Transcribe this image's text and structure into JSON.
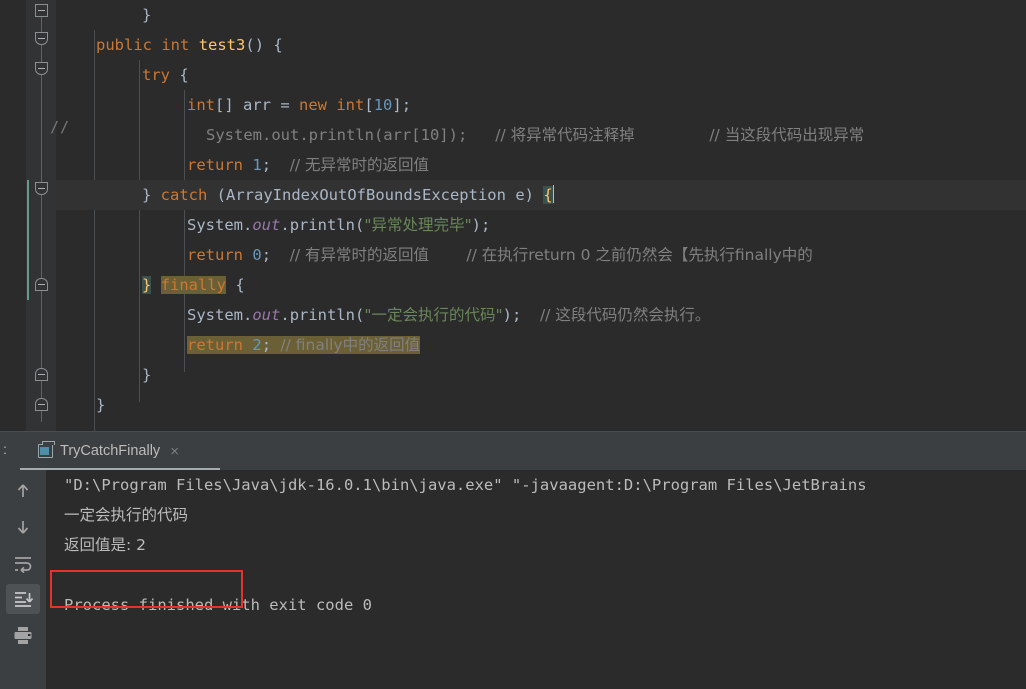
{
  "window": {
    "theme_background": "#2b2b2b",
    "accent": "#4e8fa8"
  },
  "editor": {
    "gutter": {
      "comment_marker": "//",
      "fold_markers": [
        "collapse",
        "collapse",
        "collapse",
        "collapse",
        "expanded-end",
        "expanded-end",
        "expanded-end"
      ]
    },
    "lines": [
      {
        "indent": "        ",
        "text": "}"
      },
      {
        "indent": "    ",
        "text": "public int test3() {"
      },
      {
        "indent": "        ",
        "text": "try {"
      },
      {
        "indent": "            ",
        "text": "int[] arr = new int[10];"
      },
      {
        "indent": "              ",
        "text": "System.out.println(arr[10]);   // 将异常代码注释掉        // 当这段代码出现异常"
      },
      {
        "indent": "            ",
        "text": "return 1;  // 无异常时的返回值"
      },
      {
        "indent": "        ",
        "text": "} catch (ArrayIndexOutOfBoundsException e) {"
      },
      {
        "indent": "            ",
        "text": "System.out.println(\"异常处理完毕\");"
      },
      {
        "indent": "            ",
        "text": "return 0;  // 有异常时的返回值    // 在执行return 0 之前仍然会【先执行finally中的"
      },
      {
        "indent": "        ",
        "text": "} finally {"
      },
      {
        "indent": "            ",
        "text": "System.out.println(\"一定会执行的代码\");  // 这段代码仍然会执行。"
      },
      {
        "indent": "            ",
        "text": "return 2; // finally中的返回值"
      },
      {
        "indent": "        ",
        "text": "}"
      },
      {
        "indent": "    ",
        "text": "}"
      }
    ],
    "tokens": {
      "kw_public": "public",
      "kw_int": "int",
      "method_name": "test3",
      "kw_try": "try",
      "kw_new": "new",
      "kw_return": "return",
      "kw_catch": "catch",
      "kw_finally": "finally",
      "exception_type": "ArrayIndexOutOfBoundsException",
      "var_e": "e",
      "var_arr": "arr",
      "sys": "System",
      "out": "out",
      "println": "println",
      "num_10": "10",
      "num_1": "1",
      "num_0": "0",
      "num_2": "2",
      "str_exception_done": "\"异常处理完毕\"",
      "str_always_run": "\"一定会执行的代码\"",
      "cmt_slash": "//",
      "cmt_comment_out": "// 将异常代码注释掉",
      "cmt_when_exception": "// 当这段代码出现异常",
      "cmt_no_exception_return": "// 无异常时的返回值",
      "cmt_has_exception_return": "// 有异常时的返回值",
      "cmt_before_return": "// 在执行return 0 之前仍然会【先执行finally中的",
      "cmt_still_runs": "// 这段代码仍然会执行。",
      "cmt_finally_return": "// finally中的返回值"
    },
    "highlights": {
      "search_match_color": "#6b6035",
      "brace_match_color": "#3b514d",
      "current_line_color": "#323232"
    }
  },
  "console": {
    "tab": {
      "prefix": ":",
      "label": "TryCatchFinally",
      "close": "×",
      "icon": "run-configuration-icon"
    },
    "toolbar": [
      {
        "name": "scroll-up-button",
        "glyph": "↑",
        "selected": false
      },
      {
        "name": "scroll-down-button",
        "glyph": "↓",
        "selected": false
      },
      {
        "name": "soft-wrap-button",
        "glyph": "soft-wrap",
        "selected": false
      },
      {
        "name": "scroll-to-end-button",
        "glyph": "scroll-to-end",
        "selected": true
      },
      {
        "name": "print-button",
        "glyph": "printer",
        "selected": false
      }
    ],
    "output": [
      "\"D:\\Program Files\\Java\\jdk-16.0.1\\bin\\java.exe\" \"-javaagent:D:\\Program Files\\JetBrains",
      "一定会执行的代码",
      "返回值是: 2",
      "",
      "Process finished with exit code 0"
    ],
    "annotation": {
      "name": "red-highlight-box",
      "color": "#e8312a",
      "target_text": "返回值是: 2"
    }
  }
}
